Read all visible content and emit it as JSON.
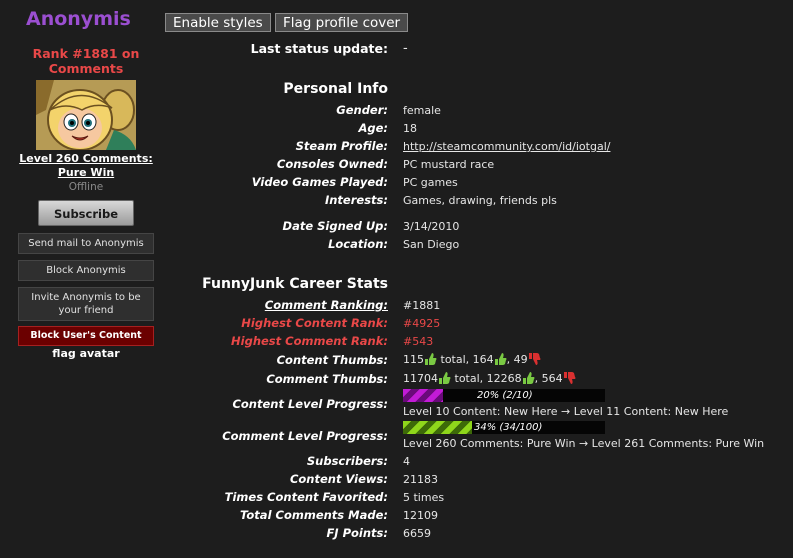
{
  "header": {
    "username": "Anonymis",
    "enable_styles": "Enable styles",
    "flag_cover": "Flag profile cover"
  },
  "sidebar": {
    "rank": "Rank #1881 on Comments",
    "level": "Level 260 Comments: Pure Win",
    "status": "Offline",
    "subscribe": "Subscribe",
    "send_mail": "Send mail to Anonymis",
    "block_user": "Block Anonymis",
    "invite": "Invite Anonymis to be your friend",
    "block_content": "Block User's Content",
    "flag_avatar": "flag avatar"
  },
  "status": {
    "label": "Last status update:",
    "value": "-"
  },
  "personal": {
    "title": "Personal Info",
    "gender_label": "Gender:",
    "gender": "female",
    "age_label": "Age:",
    "age": "18",
    "steam_label": "Steam Profile:",
    "steam": "http://steamcommunity.com/id/iotgal/",
    "consoles_label": "Consoles Owned:",
    "consoles": "PC mustard race",
    "games_label": "Video Games Played:",
    "games": "PC games",
    "interests_label": "Interests:",
    "interests": "Games, drawing, friends pls",
    "signed_label": "Date Signed Up:",
    "signed": "3/14/2010",
    "location_label": "Location:",
    "location": "San Diego"
  },
  "career": {
    "title": "FunnyJunk Career Stats",
    "comment_rank_label": "Comment Ranking:",
    "comment_rank": "#1881",
    "high_content_label": "Highest Content Rank:",
    "high_content": "#4925",
    "high_comment_label": "Highest Comment Rank:",
    "high_comment": "#543",
    "content_thumbs_label": "Content Thumbs:",
    "content_thumbs_total": "115",
    "total_word": "total,",
    "content_thumbs_up": "164",
    "content_thumbs_down": "49",
    "comment_thumbs_label": "Comment Thumbs:",
    "comment_thumbs_total": "11704",
    "comment_thumbs_up": "12268",
    "comment_thumbs_down": "564",
    "content_progress_label": "Content Level Progress:",
    "content_progress_text": "20% (2/10)",
    "content_progress_value": 0.2,
    "content_level_text": "Level 10 Content: New Here → Level 11 Content: New Here",
    "comment_progress_label": "Comment Level Progress:",
    "comment_progress_text": "34% (34/100)",
    "comment_progress_value": 0.34,
    "comment_level_text": "Level 260 Comments: Pure Win → Level 261 Comments: Pure Win",
    "subscribers_label": "Subscribers:",
    "subscribers": "4",
    "views_label": "Content Views:",
    "views": "21183",
    "favorited_label": "Times Content Favorited:",
    "favorited": "5 times",
    "comments_label": "Total Comments Made:",
    "comments": "12109",
    "points_label": "FJ Points:",
    "points": "6659"
  },
  "colors": {
    "username": "#9b4fd1",
    "rank_red": "#e94848",
    "content_bar": "#c21bd6",
    "comment_bar": "#8fd61b",
    "thumb_up": "#7ac943",
    "thumb_down": "#d93030"
  },
  "icons": {
    "thumb_up": "thumbs-up-icon",
    "thumb_down": "thumbs-down-icon"
  }
}
